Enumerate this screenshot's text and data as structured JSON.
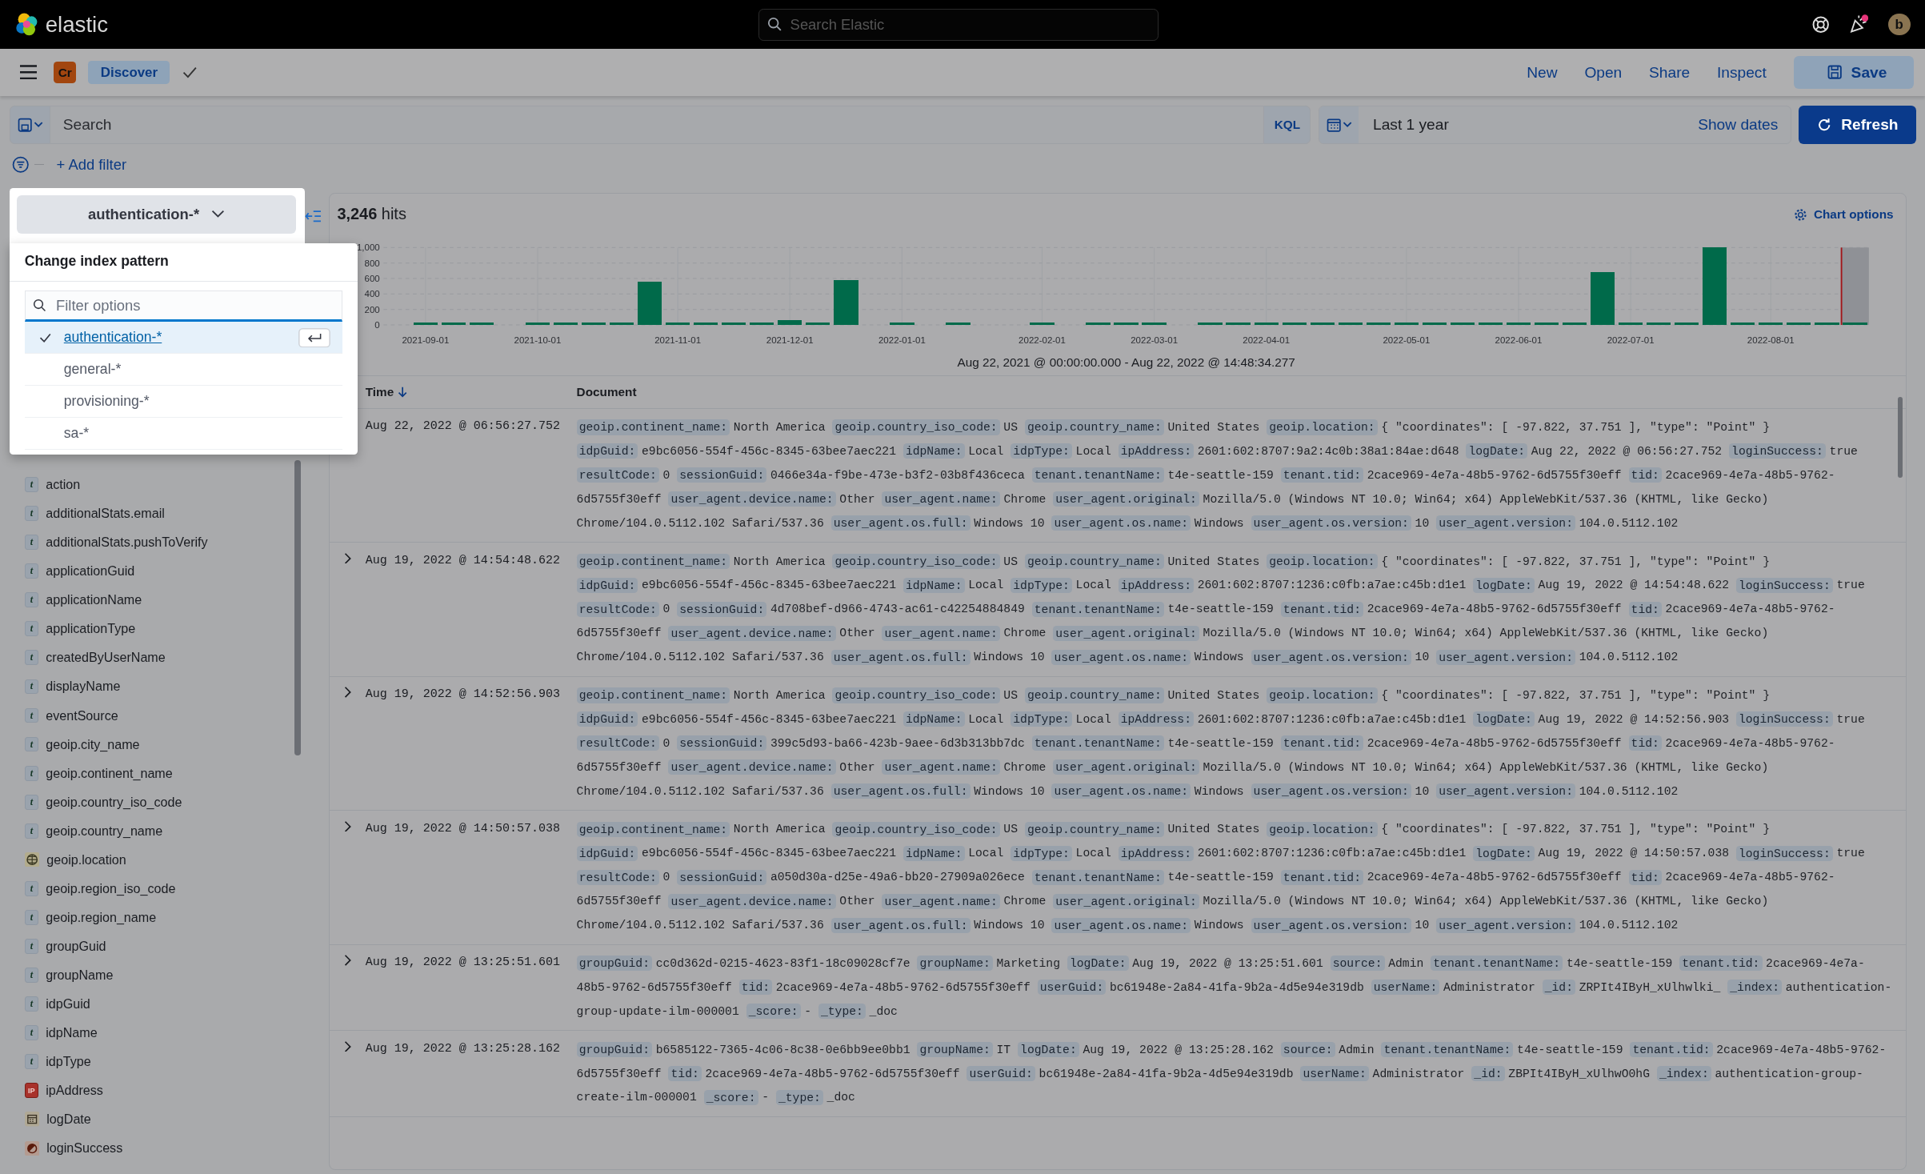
{
  "header": {
    "logo_text": "elastic",
    "search_placeholder": "Search Elastic",
    "news_unread": true,
    "avatar": "b"
  },
  "nav": {
    "space": "Cr",
    "app": "Discover",
    "links": [
      "New",
      "Open",
      "Share",
      "Inspect"
    ],
    "save": "Save"
  },
  "query": {
    "placeholder": "Search",
    "language": "KQL",
    "time_range": "Last 1 year",
    "show_dates": "Show dates",
    "refresh": "Refresh"
  },
  "filters": {
    "add_filter": "+ Add filter"
  },
  "index_pattern": {
    "current": "authentication-*",
    "popover_title": "Change index pattern",
    "filter_placeholder": "Filter options",
    "options": [
      {
        "label": "authentication-*",
        "selected": true
      },
      {
        "label": "general-*",
        "selected": false
      },
      {
        "label": "provisioning-*",
        "selected": false
      },
      {
        "label": "sa-*",
        "selected": false
      }
    ]
  },
  "sidebar": {
    "fields": [
      {
        "name": "action",
        "kind": "string",
        "badge": "t"
      },
      {
        "name": "additionalStats.email",
        "kind": "string",
        "badge": "t"
      },
      {
        "name": "additionalStats.pushToVerify",
        "kind": "string",
        "badge": "t"
      },
      {
        "name": "applicationGuid",
        "kind": "string",
        "badge": "t"
      },
      {
        "name": "applicationName",
        "kind": "string",
        "badge": "t"
      },
      {
        "name": "applicationType",
        "kind": "string",
        "badge": "t"
      },
      {
        "name": "createdByUserName",
        "kind": "string",
        "badge": "t"
      },
      {
        "name": "displayName",
        "kind": "string",
        "badge": "t"
      },
      {
        "name": "eventSource",
        "kind": "string",
        "badge": "t"
      },
      {
        "name": "geoip.city_name",
        "kind": "string",
        "badge": "t"
      },
      {
        "name": "geoip.continent_name",
        "kind": "string",
        "badge": "t"
      },
      {
        "name": "geoip.country_iso_code",
        "kind": "string",
        "badge": "t"
      },
      {
        "name": "geoip.country_name",
        "kind": "string",
        "badge": "t"
      },
      {
        "name": "geoip.location",
        "kind": "geo"
      },
      {
        "name": "geoip.region_iso_code",
        "kind": "string",
        "badge": "t"
      },
      {
        "name": "geoip.region_name",
        "kind": "string",
        "badge": "t"
      },
      {
        "name": "groupGuid",
        "kind": "string",
        "badge": "t"
      },
      {
        "name": "groupName",
        "kind": "string",
        "badge": "t"
      },
      {
        "name": "idpGuid",
        "kind": "string",
        "badge": "t"
      },
      {
        "name": "idpName",
        "kind": "string",
        "badge": "t"
      },
      {
        "name": "idpType",
        "kind": "string",
        "badge": "t"
      },
      {
        "name": "ipAddress",
        "kind": "ip",
        "badge": "IP"
      },
      {
        "name": "logDate",
        "kind": "date"
      },
      {
        "name": "loginSuccess",
        "kind": "boolean"
      }
    ]
  },
  "results": {
    "hits": "3,246",
    "hits_label": "hits",
    "chart_options": "Chart options",
    "chart_data": {
      "type": "bar",
      "xlabel": "Aug 22, 2021 @ 00:00:00.000 - Aug 22, 2022 @ 14:48:34.277",
      "categories": [
        null,
        "2021-09-01",
        null,
        null,
        null,
        "2021-10-01",
        null,
        null,
        null,
        null,
        "2021-11-01",
        null,
        null,
        null,
        "2021-12-01",
        null,
        null,
        null,
        "2022-01-01",
        null,
        null,
        null,
        null,
        "2022-02-01",
        null,
        null,
        null,
        "2022-03-01",
        null,
        null,
        null,
        "2022-04-01",
        null,
        null,
        null,
        null,
        "2022-05-01",
        null,
        null,
        null,
        "2022-06-01",
        null,
        null,
        null,
        "2022-07-01",
        null,
        null,
        null,
        null,
        "2022-08-01",
        null,
        null,
        null
      ],
      "values": [
        null,
        30,
        30,
        30,
        null,
        30,
        30,
        30,
        30,
        560,
        30,
        30,
        30,
        30,
        60,
        30,
        580,
        null,
        30,
        null,
        30,
        null,
        null,
        30,
        null,
        30,
        30,
        30,
        null,
        30,
        30,
        30,
        30,
        30,
        30,
        30,
        30,
        30,
        30,
        30,
        30,
        30,
        30,
        680,
        30,
        30,
        30,
        1000,
        30,
        30,
        30,
        30,
        30
      ],
      "ylim": [
        0,
        1000
      ],
      "grid": true,
      "yticks": [
        0,
        200,
        400,
        600,
        800,
        {
          "value": 1000,
          "label": "1,000"
        }
      ]
    },
    "columns": [
      "Time",
      "Document"
    ],
    "rows": [
      {
        "time": "Aug 22, 2022 @ 06:56:27.752",
        "expander": false,
        "fields": [
          {
            "name": "geoip.continent_name:",
            "value": "North America"
          },
          {
            "name": "geoip.country_iso_code:",
            "value": "US"
          },
          {
            "name": "geoip.country_name:",
            "value": "United States"
          },
          {
            "name": "geoip.location:",
            "value": "{ \"coordinates\": [ -97.822, 37.751 ], \"type\": \"Point\" }"
          },
          {
            "name": "idpGuid:",
            "value": "e9bc6056-554f-456c-8345-63bee7aec221"
          },
          {
            "name": "idpName:",
            "value": "Local"
          },
          {
            "name": "idpType:",
            "value": "Local"
          },
          {
            "name": "ipAddress:",
            "value": "2601:602:8707:9a2:4c0b:38a1:84ae:d648"
          },
          {
            "name": "logDate:",
            "value": "Aug 22, 2022 @ 06:56:27.752"
          },
          {
            "name": "loginSuccess:",
            "value": "true"
          },
          {
            "name": "resultCode:",
            "value": "0"
          },
          {
            "name": "sessionGuid:",
            "value": "0466e34a-f9be-473e-b3f2-03b8f436ceca"
          },
          {
            "name": "tenant.tenantName:",
            "value": "t4e-seattle-159"
          },
          {
            "name": "tenant.tid:",
            "value": "2cace969-4e7a-48b5-9762-6d5755f30eff"
          },
          {
            "name": "tid:",
            "value": "2cace969-4e7a-48b5-9762-6d5755f30eff"
          },
          {
            "name": "user_agent.device.name:",
            "value": "Other"
          },
          {
            "name": "user_agent.name:",
            "value": "Chrome"
          },
          {
            "name": "user_agent.original:",
            "value": "Mozilla/5.0 (Windows NT 10.0; Win64; x64) AppleWebKit/537.36 (KHTML, like Gecko) Chrome/104.0.5112.102 Safari/537.36"
          },
          {
            "name": "user_agent.os.full:",
            "value": "Windows 10"
          },
          {
            "name": "user_agent.os.name:",
            "value": "Windows"
          },
          {
            "name": "user_agent.os.version:",
            "value": "10"
          },
          {
            "name": "user_agent.version:",
            "value": "104.0.5112.102"
          }
        ]
      },
      {
        "time": "Aug 19, 2022 @ 14:54:48.622",
        "expander": true,
        "fields": [
          {
            "name": "geoip.continent_name:",
            "value": "North America"
          },
          {
            "name": "geoip.country_iso_code:",
            "value": "US"
          },
          {
            "name": "geoip.country_name:",
            "value": "United States"
          },
          {
            "name": "geoip.location:",
            "value": "{ \"coordinates\": [ -97.822, 37.751 ], \"type\": \"Point\" }"
          },
          {
            "name": "idpGuid:",
            "value": "e9bc6056-554f-456c-8345-63bee7aec221"
          },
          {
            "name": "idpName:",
            "value": "Local"
          },
          {
            "name": "idpType:",
            "value": "Local"
          },
          {
            "name": "ipAddress:",
            "value": "2601:602:8707:1236:c0fb:a7ae:c45b:d1e1"
          },
          {
            "name": "logDate:",
            "value": "Aug 19, 2022 @ 14:54:48.622"
          },
          {
            "name": "loginSuccess:",
            "value": "true"
          },
          {
            "name": "resultCode:",
            "value": "0"
          },
          {
            "name": "sessionGuid:",
            "value": "4d708bef-d966-4743-ac61-c42254884849"
          },
          {
            "name": "tenant.tenantName:",
            "value": "t4e-seattle-159"
          },
          {
            "name": "tenant.tid:",
            "value": "2cace969-4e7a-48b5-9762-6d5755f30eff"
          },
          {
            "name": "tid:",
            "value": "2cace969-4e7a-48b5-9762-6d5755f30eff"
          },
          {
            "name": "user_agent.device.name:",
            "value": "Other"
          },
          {
            "name": "user_agent.name:",
            "value": "Chrome"
          },
          {
            "name": "user_agent.original:",
            "value": "Mozilla/5.0 (Windows NT 10.0; Win64; x64) AppleWebKit/537.36 (KHTML, like Gecko) Chrome/104.0.5112.102 Safari/537.36"
          },
          {
            "name": "user_agent.os.full:",
            "value": "Windows 10"
          },
          {
            "name": "user_agent.os.name:",
            "value": "Windows"
          },
          {
            "name": "user_agent.os.version:",
            "value": "10"
          },
          {
            "name": "user_agent.version:",
            "value": "104.0.5112.102"
          }
        ]
      },
      {
        "time": "Aug 19, 2022 @ 14:52:56.903",
        "expander": true,
        "fields": [
          {
            "name": "geoip.continent_name:",
            "value": "North America"
          },
          {
            "name": "geoip.country_iso_code:",
            "value": "US"
          },
          {
            "name": "geoip.country_name:",
            "value": "United States"
          },
          {
            "name": "geoip.location:",
            "value": "{ \"coordinates\": [ -97.822, 37.751 ], \"type\": \"Point\" }"
          },
          {
            "name": "idpGuid:",
            "value": "e9bc6056-554f-456c-8345-63bee7aec221"
          },
          {
            "name": "idpName:",
            "value": "Local"
          },
          {
            "name": "idpType:",
            "value": "Local"
          },
          {
            "name": "ipAddress:",
            "value": "2601:602:8707:1236:c0fb:a7ae:c45b:d1e1"
          },
          {
            "name": "logDate:",
            "value": "Aug 19, 2022 @ 14:52:56.903"
          },
          {
            "name": "loginSuccess:",
            "value": "true"
          },
          {
            "name": "resultCode:",
            "value": "0"
          },
          {
            "name": "sessionGuid:",
            "value": "399c5d93-ba66-423b-9aee-6d3b313bb7dc"
          },
          {
            "name": "tenant.tenantName:",
            "value": "t4e-seattle-159"
          },
          {
            "name": "tenant.tid:",
            "value": "2cace969-4e7a-48b5-9762-6d5755f30eff"
          },
          {
            "name": "tid:",
            "value": "2cace969-4e7a-48b5-9762-6d5755f30eff"
          },
          {
            "name": "user_agent.device.name:",
            "value": "Other"
          },
          {
            "name": "user_agent.name:",
            "value": "Chrome"
          },
          {
            "name": "user_agent.original:",
            "value": "Mozilla/5.0 (Windows NT 10.0; Win64; x64) AppleWebKit/537.36 (KHTML, like Gecko) Chrome/104.0.5112.102 Safari/537.36"
          },
          {
            "name": "user_agent.os.full:",
            "value": "Windows 10"
          },
          {
            "name": "user_agent.os.name:",
            "value": "Windows"
          },
          {
            "name": "user_agent.os.version:",
            "value": "10"
          },
          {
            "name": "user_agent.version:",
            "value": "104.0.5112.102"
          }
        ]
      },
      {
        "time": "Aug 19, 2022 @ 14:50:57.038",
        "expander": true,
        "fields": [
          {
            "name": "geoip.continent_name:",
            "value": "North America"
          },
          {
            "name": "geoip.country_iso_code:",
            "value": "US"
          },
          {
            "name": "geoip.country_name:",
            "value": "United States"
          },
          {
            "name": "geoip.location:",
            "value": "{ \"coordinates\": [ -97.822, 37.751 ], \"type\": \"Point\" }"
          },
          {
            "name": "idpGuid:",
            "value": "e9bc6056-554f-456c-8345-63bee7aec221"
          },
          {
            "name": "idpName:",
            "value": "Local"
          },
          {
            "name": "idpType:",
            "value": "Local"
          },
          {
            "name": "ipAddress:",
            "value": "2601:602:8707:1236:c0fb:a7ae:c45b:d1e1"
          },
          {
            "name": "logDate:",
            "value": "Aug 19, 2022 @ 14:50:57.038"
          },
          {
            "name": "loginSuccess:",
            "value": "true"
          },
          {
            "name": "resultCode:",
            "value": "0"
          },
          {
            "name": "sessionGuid:",
            "value": "a050d30a-d25e-49a6-bb20-27909a026ece"
          },
          {
            "name": "tenant.tenantName:",
            "value": "t4e-seattle-159"
          },
          {
            "name": "tenant.tid:",
            "value": "2cace969-4e7a-48b5-9762-6d5755f30eff"
          },
          {
            "name": "tid:",
            "value": "2cace969-4e7a-48b5-9762-6d5755f30eff"
          },
          {
            "name": "user_agent.device.name:",
            "value": "Other"
          },
          {
            "name": "user_agent.name:",
            "value": "Chrome"
          },
          {
            "name": "user_agent.original:",
            "value": "Mozilla/5.0 (Windows NT 10.0; Win64; x64) AppleWebKit/537.36 (KHTML, like Gecko) Chrome/104.0.5112.102 Safari/537.36"
          },
          {
            "name": "user_agent.os.full:",
            "value": "Windows 10"
          },
          {
            "name": "user_agent.os.name:",
            "value": "Windows"
          },
          {
            "name": "user_agent.os.version:",
            "value": "10"
          },
          {
            "name": "user_agent.version:",
            "value": "104.0.5112.102"
          }
        ]
      },
      {
        "time": "Aug 19, 2022 @ 13:25:51.601",
        "expander": true,
        "fields": [
          {
            "name": "groupGuid:",
            "value": "cc0d362d-0215-4623-83f1-18c09028cf7e"
          },
          {
            "name": "groupName:",
            "value": "Marketing"
          },
          {
            "name": "logDate:",
            "value": "Aug 19, 2022 @ 13:25:51.601"
          },
          {
            "name": "source:",
            "value": "Admin"
          },
          {
            "name": "tenant.tenantName:",
            "value": "t4e-seattle-159"
          },
          {
            "name": "tenant.tid:",
            "value": "2cace969-4e7a-48b5-9762-6d5755f30eff"
          },
          {
            "name": "tid:",
            "value": "2cace969-4e7a-48b5-9762-6d5755f30eff"
          },
          {
            "name": "userGuid:",
            "value": "bc61948e-2a84-41fa-9b2a-4d5e94e319db"
          },
          {
            "name": "userName:",
            "value": "Administrator"
          },
          {
            "name": "_id:",
            "value": "ZRPIt4IByH_xUlhwlki_"
          },
          {
            "name": "_index:",
            "value": "authentication-group-update-ilm-000001"
          },
          {
            "name": "_score:",
            "value": "-"
          },
          {
            "name": "_type:",
            "value": "_doc"
          }
        ]
      },
      {
        "time": "Aug 19, 2022 @ 13:25:28.162",
        "expander": true,
        "fields": [
          {
            "name": "groupGuid:",
            "value": "b6585122-7365-4c06-8c38-0e6bb9ee0bb1"
          },
          {
            "name": "groupName:",
            "value": "IT"
          },
          {
            "name": "logDate:",
            "value": "Aug 19, 2022 @ 13:25:28.162"
          },
          {
            "name": "source:",
            "value": "Admin"
          },
          {
            "name": "tenant.tenantName:",
            "value": "t4e-seattle-159"
          },
          {
            "name": "tenant.tid:",
            "value": "2cace969-4e7a-48b5-9762-6d5755f30eff"
          },
          {
            "name": "tid:",
            "value": "2cace969-4e7a-48b5-9762-6d5755f30eff"
          },
          {
            "name": "userGuid:",
            "value": "bc61948e-2a84-41fa-9b2a-4d5e94e319db"
          },
          {
            "name": "userName:",
            "value": "Administrator"
          },
          {
            "name": "_id:",
            "value": "ZBPIt4IByH_xUlhwO0hG"
          },
          {
            "name": "_index:",
            "value": "authentication-group-create-ilm-000001"
          },
          {
            "name": "_score:",
            "value": "-"
          },
          {
            "name": "_type:",
            "value": "_doc"
          }
        ]
      }
    ]
  }
}
